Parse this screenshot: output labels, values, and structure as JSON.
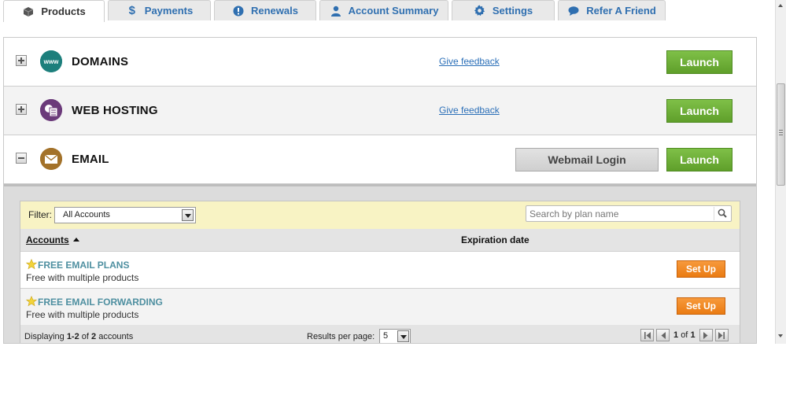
{
  "tabs": [
    {
      "label": "Products",
      "icon": "box-icon"
    },
    {
      "label": "Payments",
      "icon": "dollar-icon"
    },
    {
      "label": "Renewals",
      "icon": "alert-icon"
    },
    {
      "label": "Account Summary",
      "icon": "user-icon"
    },
    {
      "label": "Settings",
      "icon": "gear-icon"
    },
    {
      "label": "Refer A Friend",
      "icon": "chat-icon"
    }
  ],
  "colors": {
    "tab_text": "#2f6fb0",
    "launch": "#6cae36",
    "setup": "#f28a26",
    "filter_bar": "#f8f3c4",
    "plan_link": "#4e8fa0"
  },
  "products": [
    {
      "name": "DOMAINS",
      "icon": "www-icon",
      "feedback": "Give feedback",
      "launch": "Launch",
      "expanded": false
    },
    {
      "name": "WEB HOSTING",
      "icon": "hosting-icon",
      "feedback": "Give feedback",
      "launch": "Launch",
      "expanded": false
    },
    {
      "name": "EMAIL",
      "icon": "envelope-icon",
      "webmail": "Webmail Login",
      "launch": "Launch",
      "expanded": true
    }
  ],
  "email_panel": {
    "filter_label": "Filter:",
    "filter_value": "All Accounts",
    "search_placeholder": "Search by plan name",
    "columns": {
      "accounts": "Accounts",
      "expiration": "Expiration date"
    },
    "rows": [
      {
        "plan": "FREE EMAIL PLANS",
        "desc": "Free with multiple products",
        "action": "Set Up"
      },
      {
        "plan": "FREE EMAIL FORWARDING",
        "desc": "Free with multiple products",
        "action": "Set Up"
      }
    ],
    "footer": {
      "displaying_prefix": "Displaying ",
      "range": "1-2",
      "of": " of ",
      "total": "2",
      "suffix": " accounts",
      "results_per_page_label": "Results per page:",
      "results_per_page": "5",
      "page": "1",
      "page_of": "of",
      "page_total": "1"
    }
  }
}
